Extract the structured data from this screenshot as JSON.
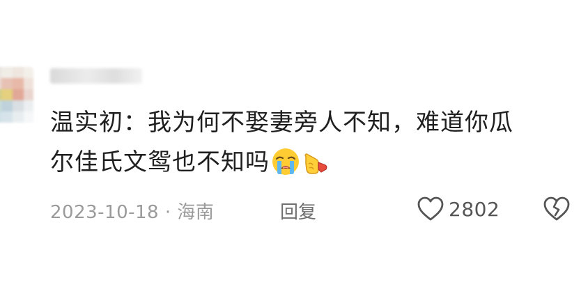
{
  "comment": {
    "text_line1": "温实初：我为何不娶妻旁人不知，难道你瓜",
    "text_line2": "尔佳氏文鸳也不知吗",
    "emojis": [
      "crying-face-emoji",
      "pointing-hand-emoji"
    ],
    "date": "2023-10-18",
    "separator": "·",
    "location": "海南",
    "reply_label": "回复",
    "like_count": "2802"
  },
  "colors": {
    "text": "#1f1f1f",
    "meta": "#9a9a9a",
    "icon": "#555555"
  }
}
